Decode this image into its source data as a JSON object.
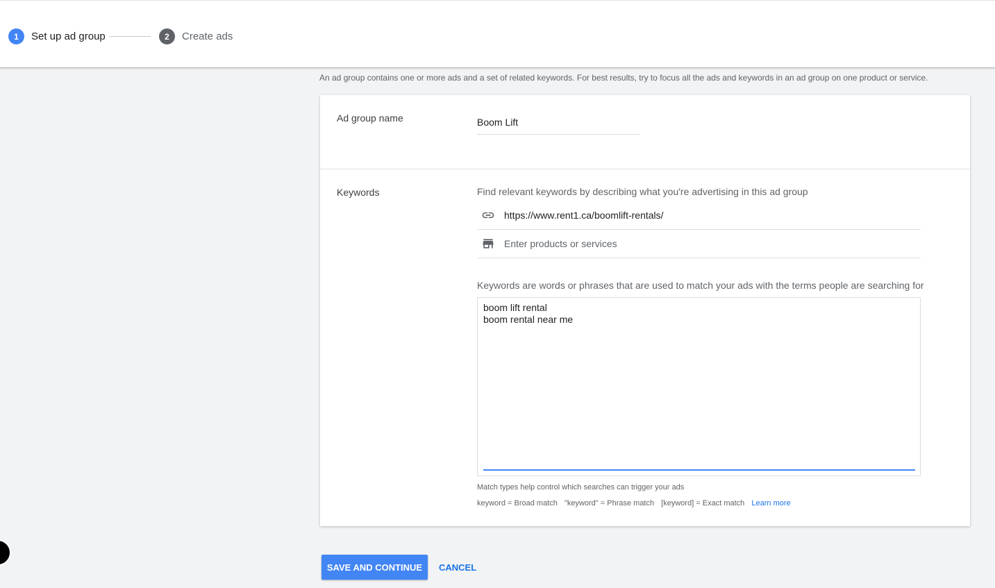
{
  "stepper": {
    "steps": [
      {
        "number": "1",
        "label": "Set up ad group",
        "state": "active"
      },
      {
        "number": "2",
        "label": "Create ads",
        "state": "inactive"
      }
    ]
  },
  "intro_text": "An ad group contains one or more ads and a set of related keywords. For best results, try to focus all the ads and keywords in an ad group on one product or service.",
  "ad_group": {
    "label": "Ad group name",
    "value": "Boom Lift"
  },
  "keywords": {
    "label": "Keywords",
    "help": "Find relevant keywords by describing what you're advertising in this ad group",
    "url_icon": "link-icon",
    "url_value": "https://www.rent1.ca/boomlift-rentals/",
    "products_icon": "store-icon",
    "products_placeholder": "Enter products or services",
    "description": "Keywords are words or phrases that are used to match your ads with the terms people are searching for",
    "entries": [
      "boom lift rental",
      "boom rental near me"
    ],
    "match_help": "Match types help control which searches can trigger your ads",
    "match_types": [
      "keyword = Broad match",
      "\"keyword\" = Phrase match",
      "[keyword] = Exact match"
    ],
    "learn_more": "Learn more"
  },
  "actions": {
    "save_label": "SAVE AND CONTINUE",
    "cancel_label": "CANCEL"
  },
  "colors": {
    "primary": "#4285f4",
    "link": "#1a73e8",
    "inactive_step": "#5f6368"
  }
}
